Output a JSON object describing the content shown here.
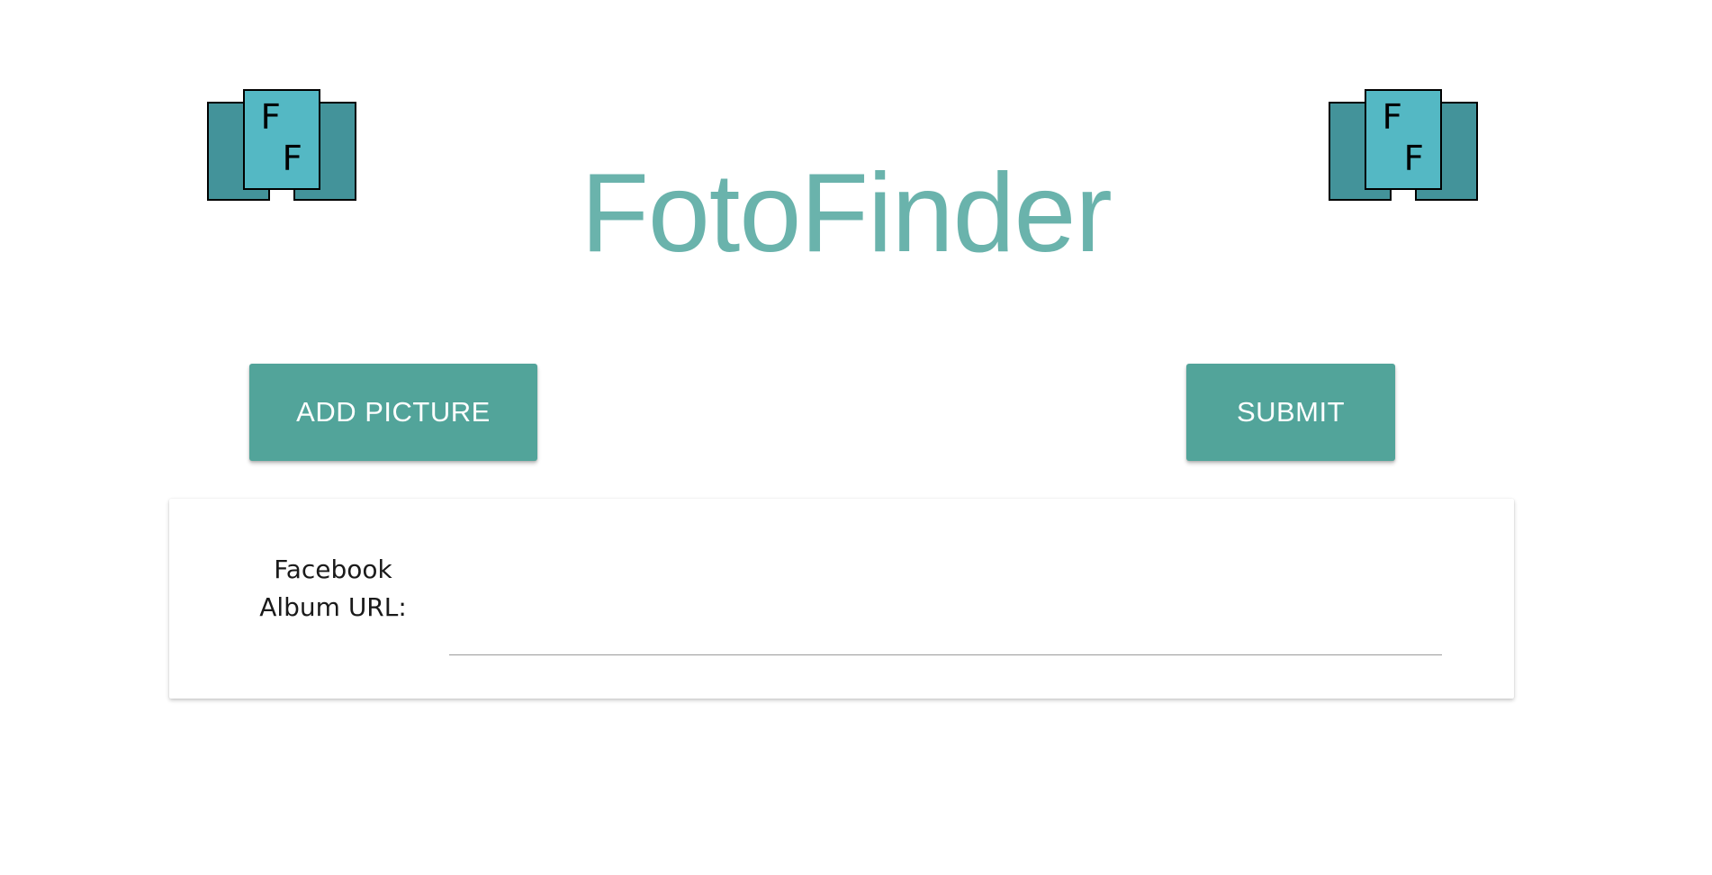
{
  "header": {
    "title": "FotoFinder",
    "logo_left": {
      "icon": "fotofinder-logo-icon",
      "letters": [
        "F",
        "F"
      ]
    },
    "logo_right": {
      "icon": "fotofinder-logo-icon",
      "letters": [
        "F",
        "F"
      ]
    }
  },
  "actions": {
    "add_picture_label": "ADD PICTURE",
    "submit_label": "SUBMIT"
  },
  "form": {
    "url_label_line1": "Facebook",
    "url_label_line2": "Album URL:",
    "url_value": "",
    "url_placeholder": ""
  },
  "colors": {
    "title": "#6ab3ac",
    "button": "#52a49a",
    "logo_dark": "#43939a",
    "logo_light": "#54b8c4"
  }
}
